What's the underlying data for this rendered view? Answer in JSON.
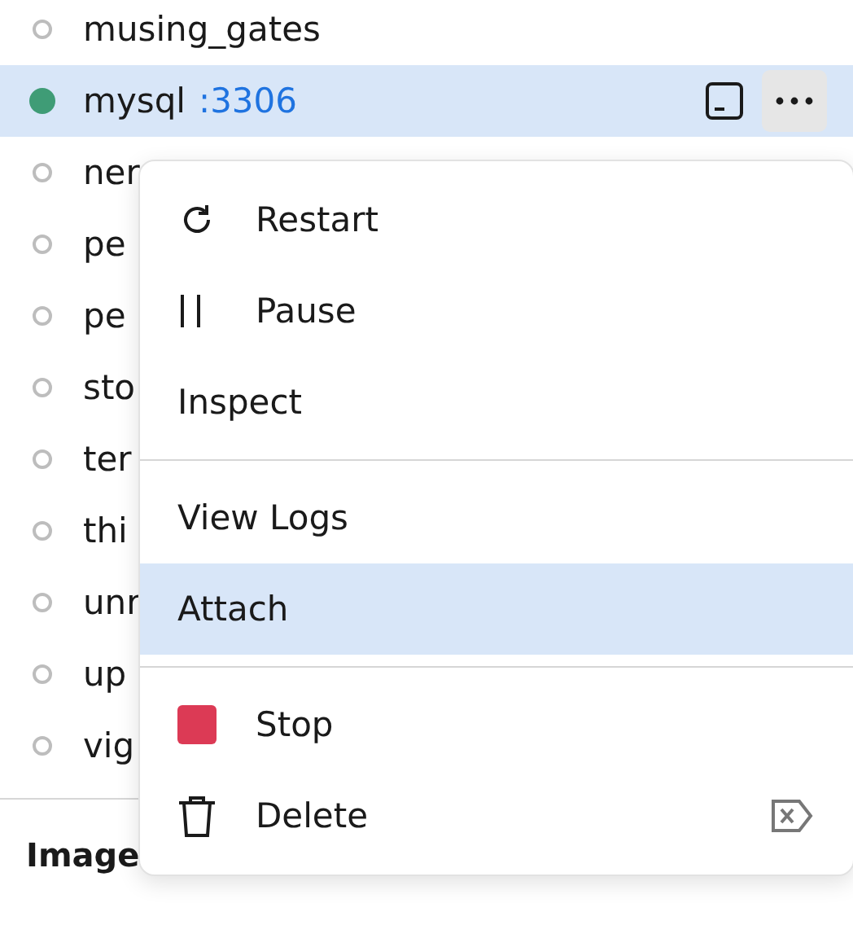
{
  "containers": [
    {
      "name": "musing_gates",
      "running": false,
      "selected": false
    },
    {
      "name": "mysql",
      "port": ":3306",
      "running": true,
      "selected": true
    },
    {
      "name": "ner",
      "running": false,
      "selected": false
    },
    {
      "name": "pe",
      "running": false,
      "selected": false
    },
    {
      "name": "pe",
      "running": false,
      "selected": false
    },
    {
      "name": "sto",
      "running": false,
      "selected": false
    },
    {
      "name": "ter",
      "running": false,
      "selected": false
    },
    {
      "name": "thi",
      "running": false,
      "selected": false
    },
    {
      "name": "unr",
      "running": false,
      "selected": false
    },
    {
      "name": "up",
      "running": false,
      "selected": false
    },
    {
      "name": "vig",
      "running": false,
      "selected": false
    }
  ],
  "section_title": "Image",
  "context_menu": {
    "items": [
      {
        "kind": "icon",
        "label": "Restart",
        "selected": false
      },
      {
        "kind": "icon",
        "label": "Pause",
        "selected": false
      },
      {
        "kind": "plain",
        "label": "Inspect",
        "selected": false
      },
      {
        "kind": "divider"
      },
      {
        "kind": "plain",
        "label": "View Logs",
        "selected": false
      },
      {
        "kind": "plain",
        "label": "Attach",
        "selected": true
      },
      {
        "kind": "divider"
      },
      {
        "kind": "icon",
        "label": "Stop",
        "selected": false
      },
      {
        "kind": "icon",
        "label": "Delete",
        "selected": false,
        "shortcut": true
      }
    ]
  }
}
